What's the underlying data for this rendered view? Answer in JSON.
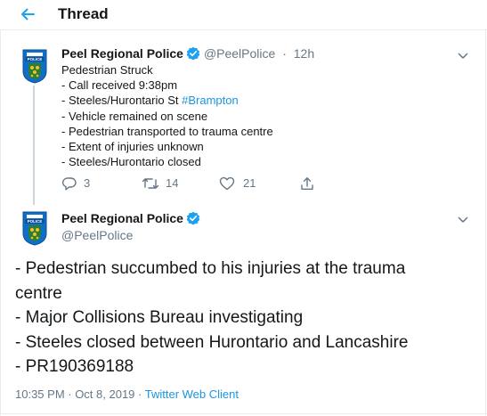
{
  "header": {
    "title": "Thread"
  },
  "tweets": [
    {
      "author_name": "Peel Regional Police",
      "handle": "@PeelPolice",
      "separator": " · ",
      "time": "12h",
      "lines": [
        {
          "text": "Pedestrian Struck"
        },
        {
          "text": "- Call received 9:38pm"
        },
        {
          "text": "- Steeles/Hurontario St ",
          "hashtag": "#Brampton"
        },
        {
          "text": "- Vehicle remained on scene"
        },
        {
          "text": "- Pedestrian transported to trauma centre"
        },
        {
          "text": "- Extent of injuries unknown"
        },
        {
          "text": "- Steeles/Hurontario closed"
        }
      ],
      "reply_count": "3",
      "retweet_count": "14",
      "like_count": "21"
    },
    {
      "author_name": "Peel Regional Police",
      "handle": "@PeelPolice",
      "lines": [
        "- Pedestrian succumbed to his injuries at the trauma",
        "centre",
        "- Major Collisions Bureau investigating",
        "- Steeles closed between Hurontario and Lancashire",
        "- PR190369188"
      ],
      "timestamp": "10:35 PM · Oct 8, 2019",
      "meta_separator": " · ",
      "client": "Twitter Web Client"
    }
  ],
  "colors": {
    "accent": "#1da1f2",
    "link": "#1b95e0",
    "muted": "#657786",
    "badge_blue": "#0f6fc6",
    "badge_green": "#2e7d32",
    "badge_yellow": "#f2c12e"
  },
  "icons": {
    "back": "arrow-left-icon",
    "verified": "verified-badge-icon",
    "caret": "chevron-down-icon",
    "reply": "reply-icon",
    "retweet": "retweet-icon",
    "like": "heart-icon",
    "share": "share-icon"
  }
}
